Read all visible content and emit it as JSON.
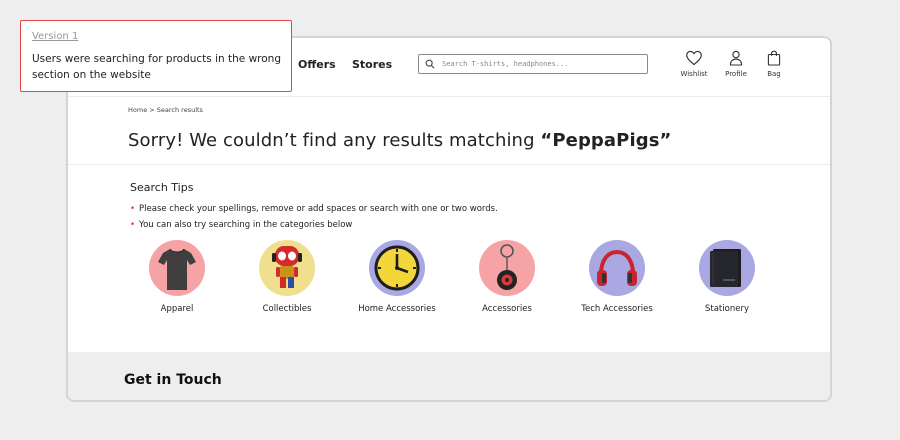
{
  "annotation": {
    "version": "Version 1",
    "note": "Users were searching for products in the wrong section on the website"
  },
  "header": {
    "nav": {
      "offers": "Offers",
      "stores": "Stores"
    },
    "search": {
      "placeholder": "Search T-shirts, headphones..."
    },
    "actions": {
      "wishlist": "Wishlist",
      "profile": "Profile",
      "bag": "Bag"
    }
  },
  "breadcrumb": "Home > Search results",
  "results": {
    "title_prefix": "Sorry! We couldn’t find any results matching ",
    "query": "“PeppaPigs”"
  },
  "tips": {
    "title": "Search Tips",
    "items": [
      "Please check your spellings, remove or add spaces or search with one or two words.",
      "You can also try searching in the categories below"
    ]
  },
  "categories": [
    {
      "label": "Apparel",
      "color": "#f6a3a6",
      "icon": "t-shirt-icon"
    },
    {
      "label": "Collectibles",
      "color": "#f0e08d",
      "icon": "figurine-icon"
    },
    {
      "label": "Home Accessories",
      "color": "#a9a8e2",
      "icon": "clock-icon"
    },
    {
      "label": "Accessories",
      "color": "#f6a3a6",
      "icon": "keychain-icon"
    },
    {
      "label": "Tech Accessories",
      "color": "#a9a8e2",
      "icon": "headphones-icon"
    },
    {
      "label": "Stationery",
      "color": "#a9a8e2",
      "icon": "notebook-icon"
    }
  ],
  "footer": {
    "title": "Get in Touch"
  },
  "colors": {
    "accent_red": "#e04848",
    "bullet_red": "#d83a3a"
  }
}
